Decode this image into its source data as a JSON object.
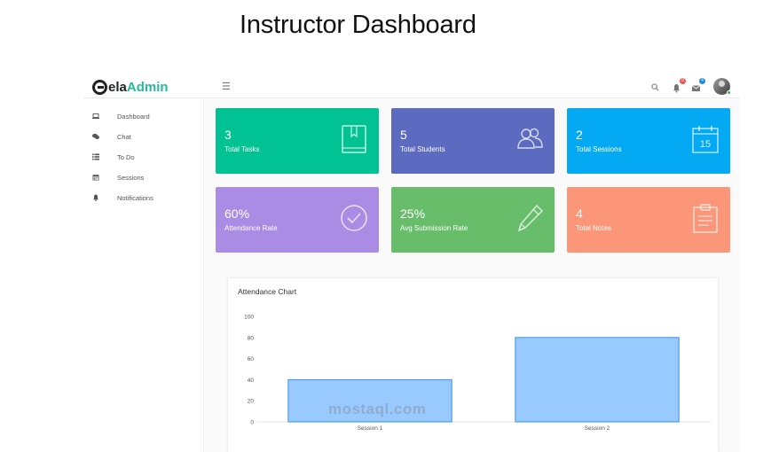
{
  "page": {
    "heading": "Instructor Dashboard"
  },
  "brand": {
    "part1": "ela",
    "part2": "Admin"
  },
  "topbar": {
    "notifications_badge": "0",
    "messages_badge": "4"
  },
  "sidebar": {
    "items": [
      {
        "label": "Dashboard",
        "icon": "laptop-icon"
      },
      {
        "label": "Chat",
        "icon": "chat-icon"
      },
      {
        "label": "To Do",
        "icon": "list-icon"
      },
      {
        "label": "Sessions",
        "icon": "calendar-icon"
      },
      {
        "label": "Notifications",
        "icon": "bell-icon"
      }
    ]
  },
  "cards": [
    {
      "value": "3",
      "label": "Total Tasks",
      "color": "#00c292",
      "icon": "book-icon"
    },
    {
      "value": "5",
      "label": "Total Students",
      "color": "#5c6bc0",
      "icon": "users-icon"
    },
    {
      "value": "2",
      "label": "Total Sessions",
      "color": "#03a9f3",
      "icon": "calendar-icon",
      "icon_text": "15"
    },
    {
      "value": "60%",
      "label": "Attendance Rate",
      "color": "#ab8ce4",
      "icon": "check-circle-icon"
    },
    {
      "value": "25%",
      "label": "Avg Submission Rate",
      "color": "#67bd6a",
      "icon": "pencil-icon"
    },
    {
      "value": "4",
      "label": "Total Notes",
      "color": "#fb9678",
      "icon": "clipboard-icon"
    }
  ],
  "chart_data": {
    "type": "bar",
    "title": "Attendance Chart",
    "categories": [
      "Session 1",
      "Session 2"
    ],
    "values": [
      40,
      80
    ],
    "ylim": [
      0,
      100
    ],
    "yticks": [
      0,
      20,
      40,
      60,
      80,
      100
    ],
    "bar_color": "#99caff",
    "bar_border": "#3d8fe0"
  },
  "watermark": "mostaql.com"
}
